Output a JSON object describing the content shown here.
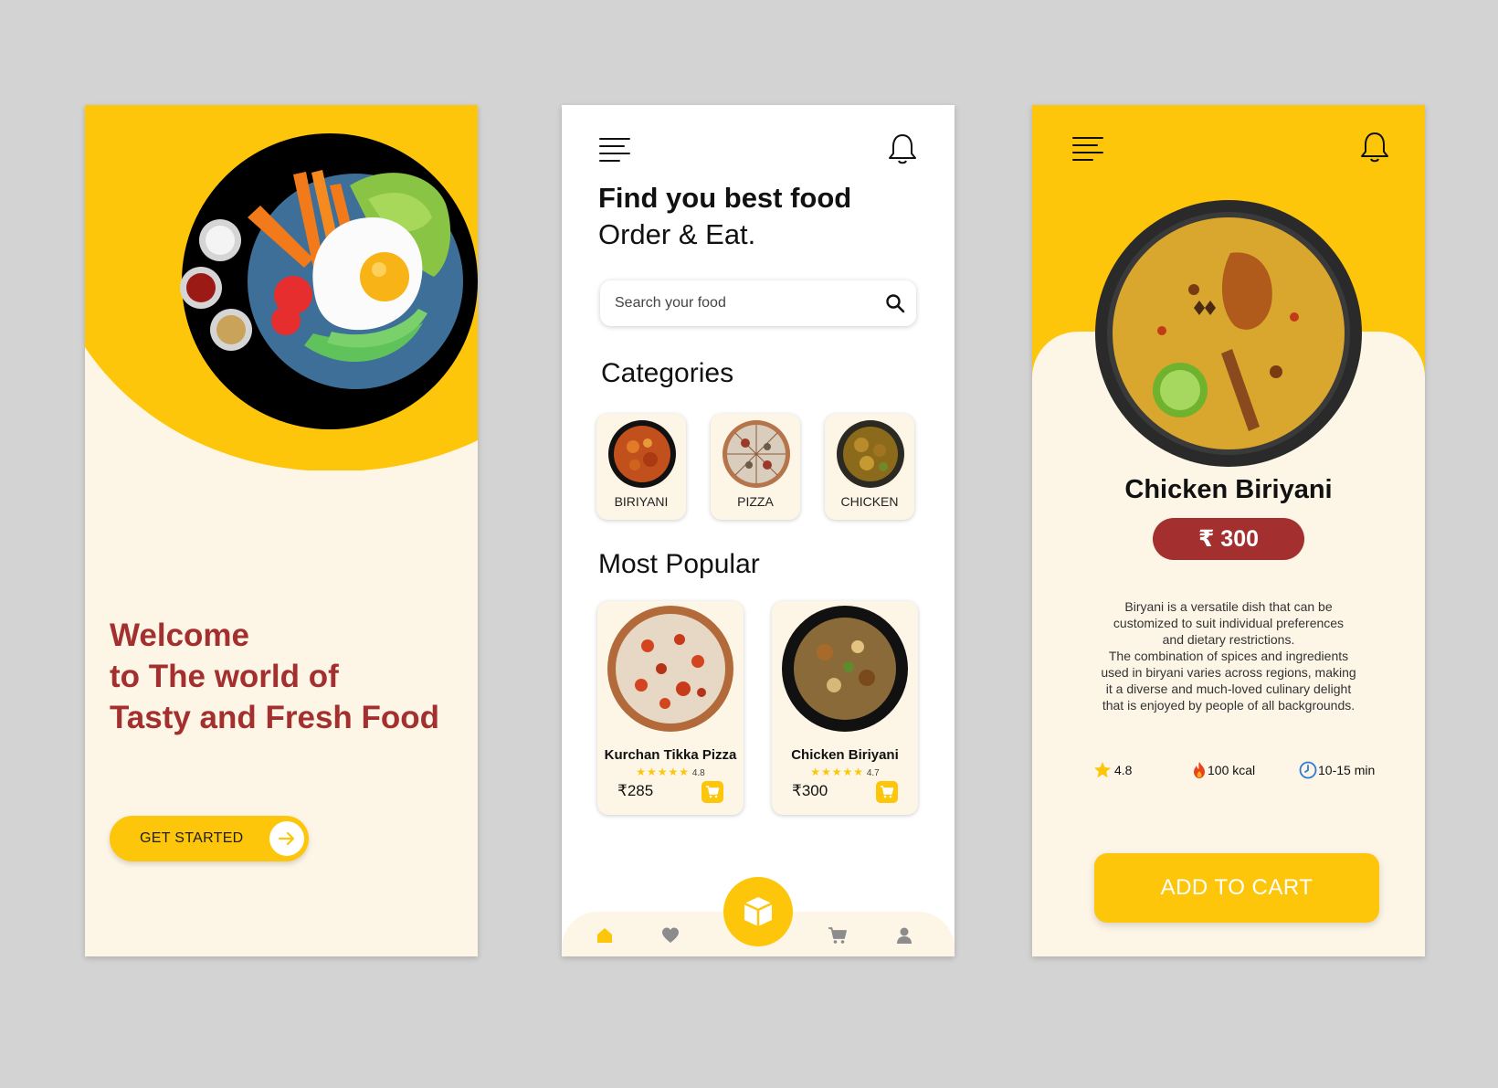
{
  "welcome_screen": {
    "headline_lines": [
      "Welcome",
      "to The world of",
      "Tasty and Fresh Food"
    ],
    "get_started_label": "GET STARTED",
    "colors": {
      "yellow": "#fdc60a",
      "cream": "#fdf5e6",
      "maroon": "#a3302f"
    }
  },
  "home_screen": {
    "title_line1": "Find you best food",
    "title_line2": "Order & Eat.",
    "search": {
      "placeholder": "Search your food"
    },
    "categories_title": "Categories",
    "categories": [
      {
        "label": "BIRIYANI",
        "icon": "biriyani-image"
      },
      {
        "label": "PIZZA",
        "icon": "pizza-image"
      },
      {
        "label": "CHICKEN",
        "icon": "chicken-image"
      }
    ],
    "popular_title": "Most Popular",
    "popular": [
      {
        "name": "Kurchan Tikka Pizza",
        "rating": "4.8",
        "stars": "★★★★★",
        "price": "₹285"
      },
      {
        "name": "Chicken Biriyani",
        "rating": "4.7",
        "stars": "★★★★★",
        "price": "₹300"
      }
    ],
    "bottom_nav": [
      "home-icon",
      "heart-icon",
      "box-icon",
      "cart-icon",
      "profile-icon"
    ]
  },
  "detail_screen": {
    "dish_name": "Chicken Biriyani",
    "price": "₹ 300",
    "description": "Biryani is a versatile dish that can be\ncustomized to suit individual preferences\nand dietary restrictions.\nThe combination of spices and ingredients\nused in biryani varies across regions, making\nit a diverse and much-loved culinary delight\nthat is enjoyed by people of all backgrounds.",
    "stats": {
      "rating": "4.8",
      "calories": "100 kcal",
      "time": "10-15 min"
    },
    "add_to_cart_label": "ADD TO CART"
  }
}
